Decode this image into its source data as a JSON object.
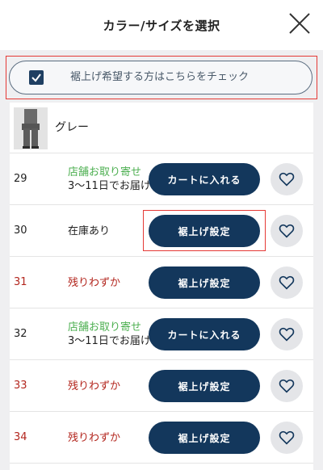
{
  "header": {
    "title": "カラー/サイズを選択",
    "close_icon": "close-icon"
  },
  "hem_option": {
    "label": "裾上げ希望する方はこちらをチェック",
    "checked": true
  },
  "color": {
    "name": "グレー"
  },
  "rows": [
    {
      "size": "29",
      "stock_line1": "店舗お取り寄せ",
      "stock_line2": "3〜11日でお届け",
      "stock_status": "order",
      "button": "カートに入れる",
      "favorite_icon": "heart-icon"
    },
    {
      "size": "30",
      "stock_line1": "在庫あり",
      "stock_status": "in-stock",
      "button": "裾上げ設定",
      "favorite_icon": "heart-icon"
    },
    {
      "size": "31",
      "stock_line1": "残りわずか",
      "stock_status": "low",
      "button": "裾上げ設定",
      "favorite_icon": "heart-icon"
    },
    {
      "size": "32",
      "stock_line1": "店舗お取り寄せ",
      "stock_line2": "3〜11日でお届け",
      "stock_status": "order",
      "button": "カートに入れる",
      "favorite_icon": "heart-icon"
    },
    {
      "size": "33",
      "stock_line1": "残りわずか",
      "stock_status": "low",
      "button": "裾上げ設定",
      "favorite_icon": "heart-icon"
    },
    {
      "size": "34",
      "stock_line1": "残りわずか",
      "stock_status": "low",
      "button": "裾上げ設定",
      "favorite_icon": "heart-icon"
    }
  ],
  "colors": {
    "button_bg": "#13375c",
    "order_text": "#4caf50",
    "low_text": "#b3261e",
    "highlight": "#e53935"
  }
}
